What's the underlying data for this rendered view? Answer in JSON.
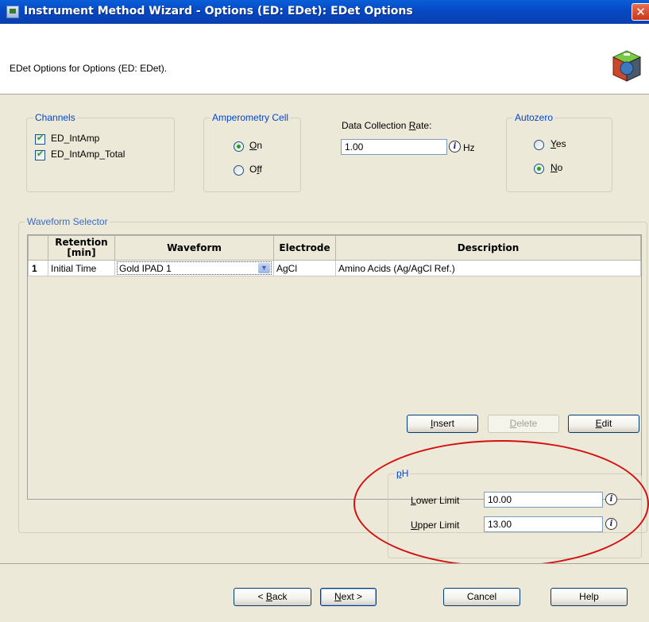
{
  "window": {
    "title": "Instrument Method Wizard - Options (ED: EDet): EDet Options",
    "close": "✕"
  },
  "header": {
    "subtitle": "EDet Options for Options (ED: EDet)."
  },
  "channels": {
    "label": "Channels",
    "items": [
      {
        "label": "ED_IntAmp",
        "checked": true
      },
      {
        "label": "ED_IntAmp_Total",
        "checked": true
      }
    ]
  },
  "amperometry": {
    "label": "Amperometry Cell",
    "on_prefix": "",
    "on_u": "O",
    "on_rest": "n",
    "off_prefix": "O",
    "off_u": "f",
    "off_rest": "f",
    "selected": "On"
  },
  "rate": {
    "label_prefix": "Data Collection ",
    "label_u": "R",
    "label_rest": "ate:",
    "value": "1.00",
    "unit": "Hz"
  },
  "autozero": {
    "label": "Autozero",
    "yes_u": "Y",
    "yes_rest": "es",
    "no_u": "N",
    "no_rest": "o",
    "selected": "No"
  },
  "waveform": {
    "label": "Waveform Selector",
    "columns": [
      "",
      "Retention\n[min]",
      "Waveform",
      "Electrode",
      "Description"
    ],
    "col_retention_1": "Retention",
    "col_retention_2": "[min]",
    "col_waveform": "Waveform",
    "col_electrode": "Electrode",
    "col_description": "Description",
    "rows": [
      {
        "num": "1",
        "retention": "Initial Time",
        "waveform": "Gold IPAD 1",
        "electrode": "AgCl",
        "description": "Amino Acids (Ag/AgCl Ref.)"
      }
    ],
    "buttons": {
      "insert_u": "I",
      "insert_rest": "nsert",
      "delete_u": "D",
      "delete_rest": "elete",
      "edit_u": "E",
      "edit_rest": "dit"
    }
  },
  "ph": {
    "label_u": "p",
    "label_rest": "H",
    "lower_u": "L",
    "lower_rest": "ower Limit",
    "lower_value": "10.00",
    "upper_u": "U",
    "upper_rest": "pper Limit",
    "upper_value": "13.00"
  },
  "footer": {
    "back_prefix": "< ",
    "back_u": "B",
    "back_rest": "ack",
    "next_u": "N",
    "next_rest": "ext >",
    "cancel": "Cancel",
    "help": "Help"
  },
  "colors": {
    "group_label": "#0046d5",
    "title_bar": "#0a5fd8",
    "highlight_ellipse": "#d41010",
    "check": "#21a121"
  }
}
